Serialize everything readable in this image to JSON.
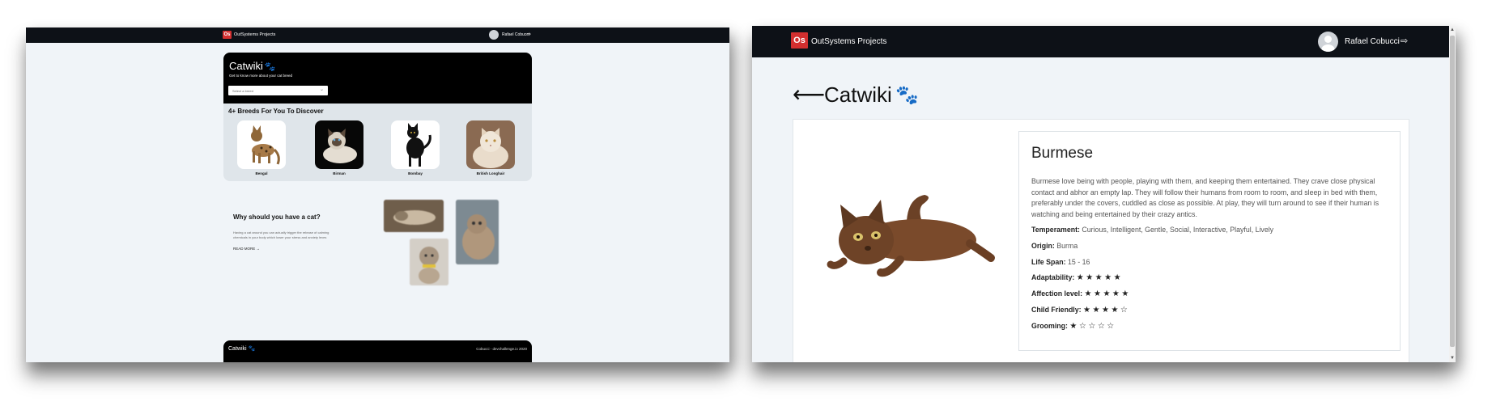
{
  "left_page": {
    "nav": {
      "logo_text": "Os",
      "brand": "OutSystems Projects",
      "user_name": "Rafael Cobucci"
    },
    "hero": {
      "title": "Catwiki",
      "subtitle": "Get to know more about your cat breed",
      "select_placeholder": "Select a breed"
    },
    "breeds": {
      "heading": "4+ Breeds For You To Discover",
      "items": [
        {
          "label": "Bengal"
        },
        {
          "label": "Birman"
        },
        {
          "label": "Bombay"
        },
        {
          "label": "British Longhair"
        }
      ]
    },
    "why": {
      "title": "Why should you have a cat?",
      "text": "Having a cat around you can actually trigger the release of calming chemicals in your body which lower your stress and anxiety leves",
      "read_more": "READ MORE"
    },
    "footer": {
      "brand": "Catwiki",
      "credit": "Cobucci - devchallenge.io 2020"
    }
  },
  "right_page": {
    "nav": {
      "logo_text": "Os",
      "brand": "OutSystems Projects",
      "user_name": "Rafael Cobucci"
    },
    "title": "Catwiki",
    "breed": {
      "name": "Burmese",
      "description": "Burmese love being with people, playing with them, and keeping them entertained. They crave close physical contact and abhor an empty lap. They will follow their humans from room to room, and sleep in bed with them, preferably under the covers, cuddled as close as possible. At play, they will turn around to see if their human is watching and being entertained by their crazy antics.",
      "temperament_label": "Temperament:",
      "temperament": "Curious, Intelligent, Gentle, Social, Interactive, Playful, Lively",
      "origin_label": "Origin:",
      "origin": "Burma",
      "life_span_label": "Life Span:",
      "life_span": "15 - 16",
      "ratings": [
        {
          "label": "Adaptability:",
          "value": 5,
          "max": 5
        },
        {
          "label": "Affection level:",
          "value": 5,
          "max": 5
        },
        {
          "label": "Child Friendly:",
          "value": 4,
          "max": 5
        },
        {
          "label": "Grooming:",
          "value": 1,
          "max": 5
        }
      ]
    }
  }
}
